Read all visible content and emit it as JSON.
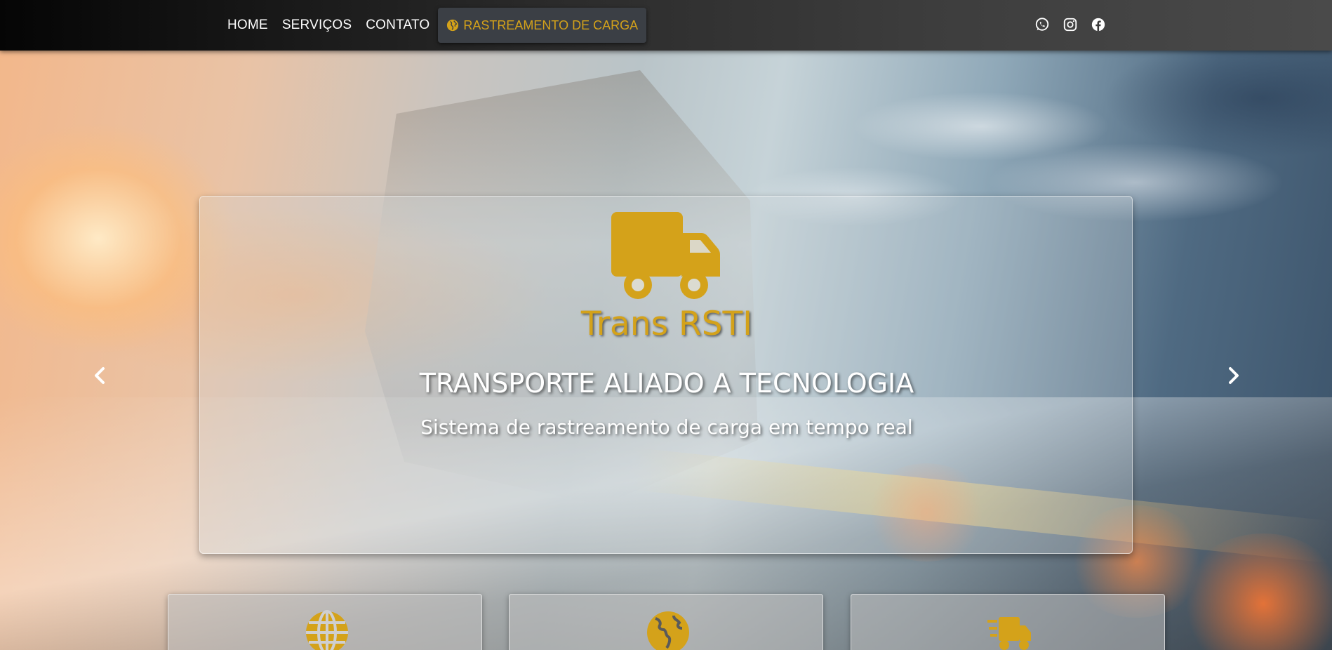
{
  "nav": {
    "links": [
      "HOME",
      "SERVIÇOS",
      "CONTATO"
    ],
    "tracking_label": "RASTREAMENTO DE CARGA",
    "tracking_icon": "globe-africa-icon",
    "social": [
      "whatsapp-icon",
      "instagram-icon",
      "facebook-icon"
    ]
  },
  "hero": {
    "logo_icon": "truck-icon",
    "brand": "Trans RSTI",
    "headline": "TRANSPORTE ALIADO A TECNOLOGIA",
    "subline": "Sistema de rastreamento de carga em tempo real",
    "prev_icon": "chevron-left-icon",
    "next_icon": "chevron-right-icon"
  },
  "cards": [
    {
      "icon": "globe-icon"
    },
    {
      "icon": "globe-americas-icon"
    },
    {
      "icon": "shipping-fast-icon"
    }
  ],
  "colors": {
    "accent": "#d4a21a",
    "navbar": "#2a2a2a",
    "text": "#ffffff"
  }
}
